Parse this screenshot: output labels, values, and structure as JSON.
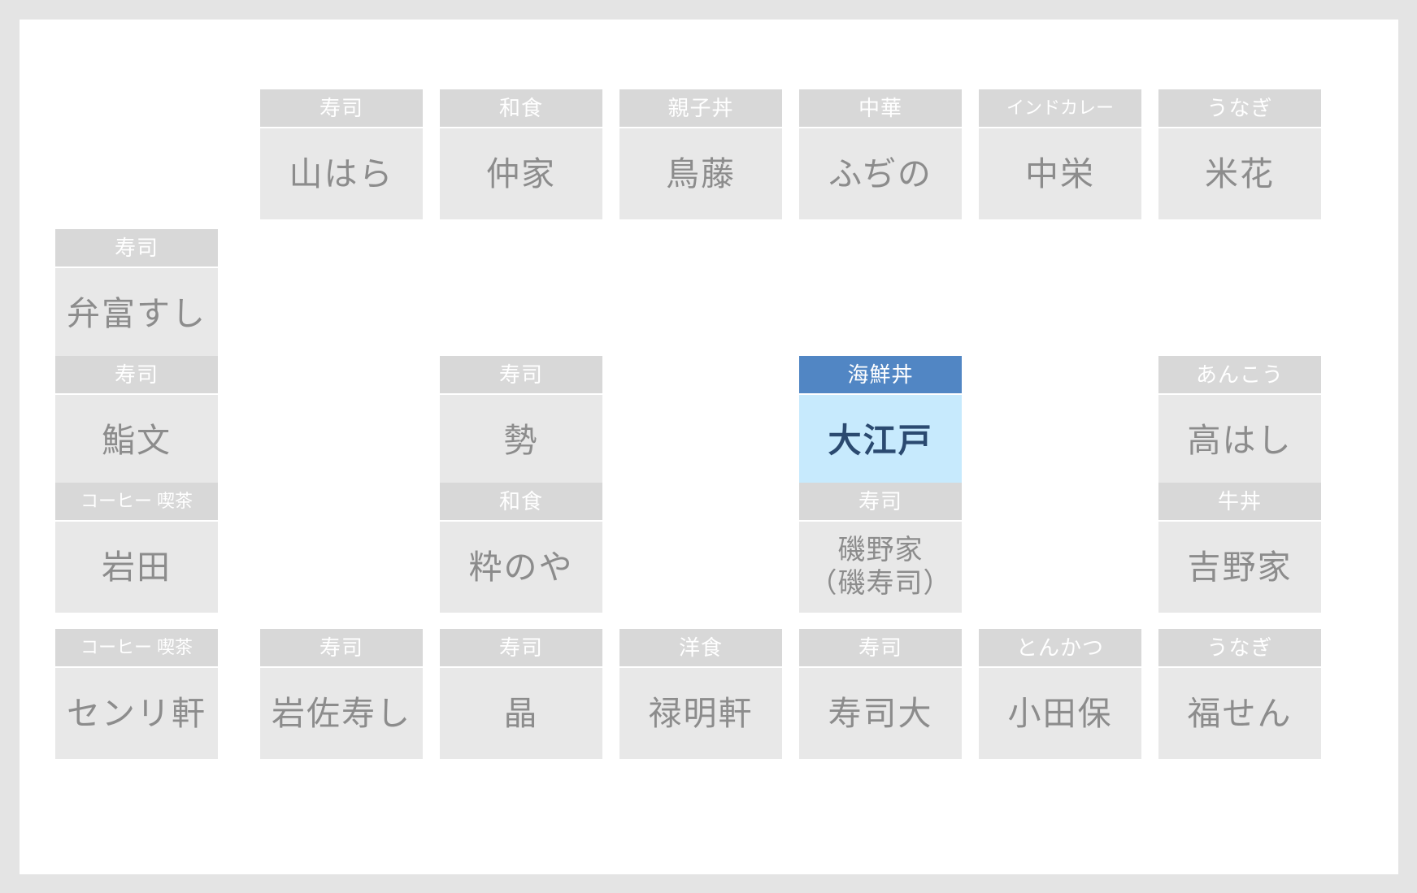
{
  "map": {
    "background_color": "#e4e4e4",
    "canvas_color": "#ffffff",
    "genre_header_color": "#d8d8d8",
    "name_body_color": "#e8e8e8",
    "selected_header_color": "#5186c4",
    "selected_body_color": "#c7eafd",
    "selected_shop": "大江戸"
  },
  "shops": [
    {
      "genre": "寿司",
      "name": "山はら",
      "col": 1,
      "row": 0,
      "selected": false
    },
    {
      "genre": "和食",
      "name": "仲家",
      "col": 2,
      "row": 0,
      "selected": false
    },
    {
      "genre": "親子丼",
      "name": "鳥藤",
      "col": 3,
      "row": 0,
      "selected": false
    },
    {
      "genre": "中華",
      "name": "ふぢの",
      "col": 4,
      "row": 0,
      "selected": false
    },
    {
      "genre": "インドカレー",
      "name": "中栄",
      "col": 5,
      "row": 0,
      "selected": false
    },
    {
      "genre": "うなぎ",
      "name": "米花",
      "col": 6,
      "row": 0,
      "selected": false
    },
    {
      "genre": "寿司",
      "name": "弁富すし",
      "col": 0,
      "row": 1,
      "selected": false
    },
    {
      "genre": "寿司",
      "name": "鮨文",
      "col": 0,
      "row": 2,
      "selected": false
    },
    {
      "genre": "寿司",
      "name": "勢",
      "col": 2,
      "row": 2,
      "selected": false
    },
    {
      "genre": "海鮮丼",
      "name": "大江戸",
      "col": 4,
      "row": 2,
      "selected": true
    },
    {
      "genre": "あんこう",
      "name": "高はし",
      "col": 6,
      "row": 2,
      "selected": false
    },
    {
      "genre": "コーヒー 喫茶",
      "name": "岩田",
      "col": 0,
      "row": 3,
      "selected": false
    },
    {
      "genre": "和食",
      "name": "粋のや",
      "col": 2,
      "row": 3,
      "selected": false
    },
    {
      "genre": "寿司",
      "name": "磯野家\n（磯寿司）",
      "col": 4,
      "row": 3,
      "selected": false
    },
    {
      "genre": "牛丼",
      "name": "吉野家",
      "col": 6,
      "row": 3,
      "selected": false
    },
    {
      "genre": "コーヒー 喫茶",
      "name": "センリ軒",
      "col": 0,
      "row": 5,
      "selected": false
    },
    {
      "genre": "寿司",
      "name": "岩佐寿し",
      "col": 1,
      "row": 5,
      "selected": false
    },
    {
      "genre": "寿司",
      "name": "晶",
      "col": 2,
      "row": 5,
      "selected": false
    },
    {
      "genre": "洋食",
      "name": "禄明軒",
      "col": 3,
      "row": 5,
      "selected": false
    },
    {
      "genre": "寿司",
      "name": "寿司大",
      "col": 4,
      "row": 5,
      "selected": false
    },
    {
      "genre": "とんかつ",
      "name": "小田保",
      "col": 5,
      "row": 5,
      "selected": false
    },
    {
      "genre": "うなぎ",
      "name": "福せん",
      "col": 6,
      "row": 5,
      "selected": false
    }
  ]
}
